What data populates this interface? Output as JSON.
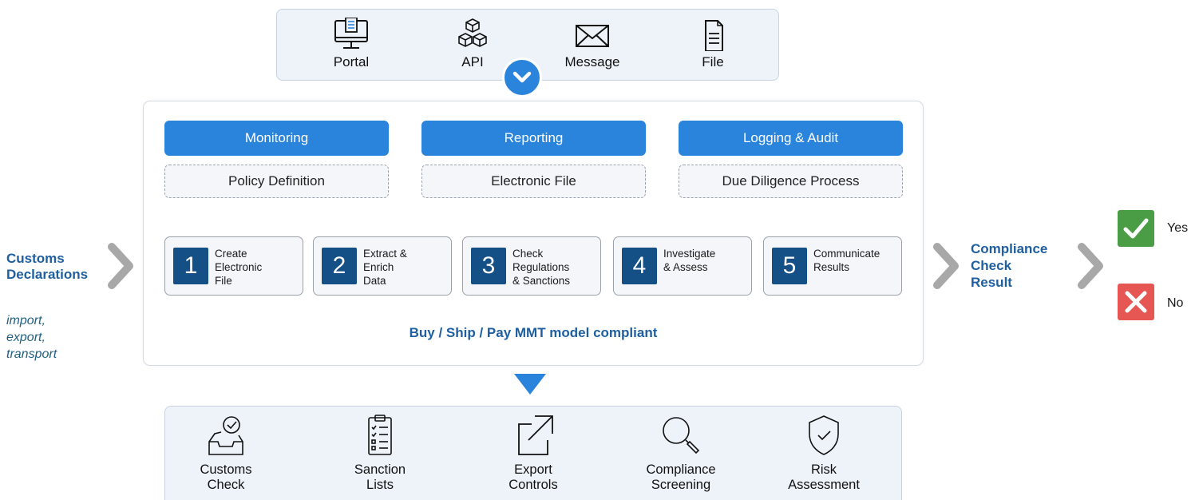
{
  "channels": [
    {
      "label": "Portal",
      "icon": "portal-icon"
    },
    {
      "label": "API",
      "icon": "api-icon"
    },
    {
      "label": "Message",
      "icon": "message-icon"
    },
    {
      "label": "File",
      "icon": "file-icon"
    }
  ],
  "main": {
    "top_buttons": [
      "Monitoring",
      "Reporting",
      "Logging & Audit"
    ],
    "dashed_boxes": [
      "Policy Definition",
      "Electronic File",
      "Due Diligence Process"
    ],
    "steps": [
      {
        "num": "1",
        "text": "Create\nElectronic\nFile"
      },
      {
        "num": "2",
        "text": "Extract &\nEnrich\nData"
      },
      {
        "num": "3",
        "text": "Check\nRegulations\n& Sanctions"
      },
      {
        "num": "4",
        "text": "Investigate\n& Assess"
      },
      {
        "num": "5",
        "text": "Communicate\nResults"
      }
    ],
    "footer": "Buy / Ship / Pay MMT model compliant"
  },
  "left": {
    "title_line1": "Customs",
    "title_line2": "Declarations",
    "subtitle": "import,\nexport,\ntransport"
  },
  "result": {
    "title": "Compliance\nCheck\nResult",
    "yes": "Yes",
    "no": "No"
  },
  "bottom": [
    {
      "label": "Customs\nCheck",
      "icon": "customs-check-icon"
    },
    {
      "label": "Sanction\nLists",
      "icon": "checklist-icon"
    },
    {
      "label": "Export\nControls",
      "icon": "export-icon"
    },
    {
      "label": "Compliance\nScreening",
      "icon": "search-icon"
    },
    {
      "label": "Risk\nAssessment",
      "icon": "shield-check-icon"
    }
  ],
  "colors": {
    "accent_blue": "#2a84dc",
    "dark_blue": "#144f86",
    "text_blue": "#1f5fa0",
    "yes_green": "#4a9d45",
    "no_red": "#e65653"
  }
}
